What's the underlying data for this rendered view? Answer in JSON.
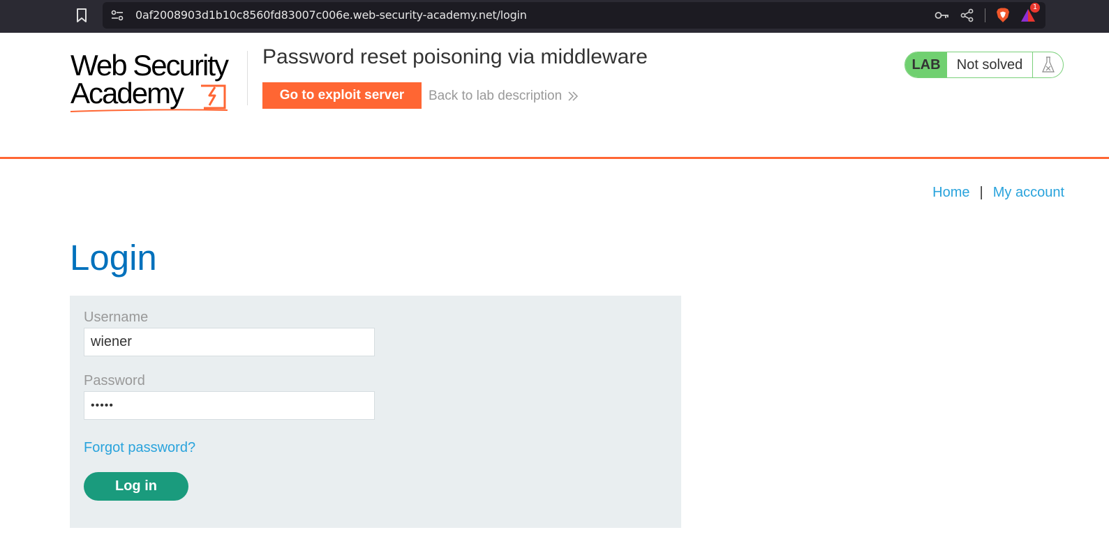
{
  "browser": {
    "url": "0af2008903d1b10c8560fd83007c006e.web-security-academy.net/login",
    "notification_count": "1"
  },
  "header": {
    "logo_line1": "Web Security",
    "logo_line2": "Academy",
    "lab_title": "Password reset poisoning via middleware",
    "exploit_button": "Go to exploit server",
    "back_link": "Back to lab description",
    "lab_badge": "LAB",
    "lab_status": "Not solved"
  },
  "nav": {
    "home": "Home",
    "separator": "|",
    "my_account": "My account"
  },
  "login": {
    "heading": "Login",
    "username_label": "Username",
    "username_value": "wiener",
    "password_label": "Password",
    "password_value": "•••••",
    "forgot_link": "Forgot password?",
    "submit_label": "Log in"
  },
  "colors": {
    "accent_orange": "#ff6633",
    "link_blue": "#29a3dc",
    "heading_blue": "#0071bc",
    "button_green": "#1a9b7d",
    "lab_green": "#70d070"
  },
  "icons": [
    "bookmark-icon",
    "site-info-icon",
    "key-icon",
    "share-icon",
    "brave-shield-icon",
    "brave-rewards-icon",
    "chevron-double-right-icon",
    "flask-icon"
  ]
}
